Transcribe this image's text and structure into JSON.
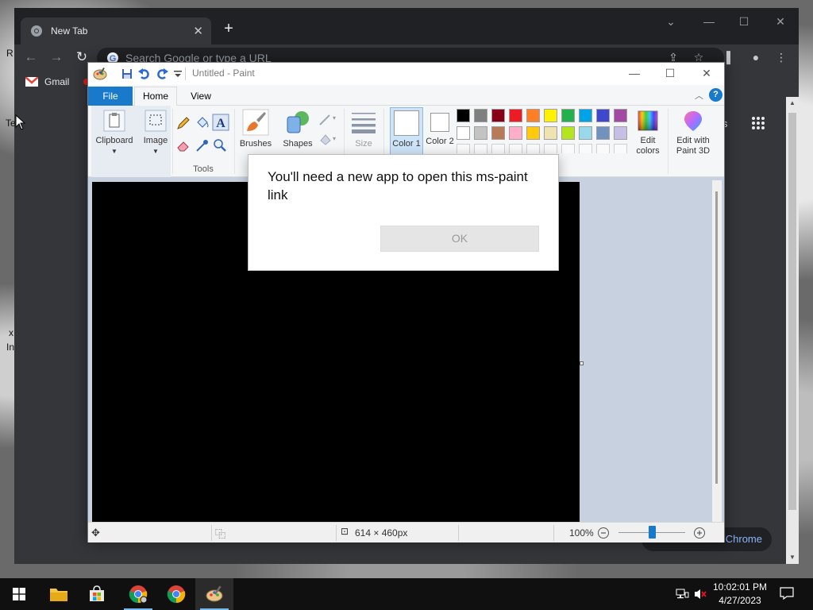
{
  "chrome": {
    "tab_title": "New Tab",
    "tab_close": "✕",
    "new_tab": "+",
    "omnibox_placeholder": "Search Google or type a URL",
    "bookmark_gmail": "Gmail",
    "shortcut_label": "s",
    "customize_label": "Chrome",
    "left_partial_1": "R",
    "left_partial_2": "Te",
    "left_partial_3": "x",
    "left_partial_4": "In"
  },
  "paint": {
    "window_title": "Untitled - Paint",
    "tabs": {
      "file": "File",
      "home": "Home",
      "view": "View"
    },
    "help": "?",
    "ribbon": {
      "clipboard": "Clipboard",
      "image": "Image",
      "tools": "Tools",
      "brushes": "Brushes",
      "shapes": "Shapes",
      "size": "Size",
      "color1": "Color 1",
      "color2": "Color 2",
      "edit_colors": "Edit colors",
      "edit_paint3d": "Edit with Paint 3D"
    },
    "palette_row1": [
      "#000000",
      "#7f7f7f",
      "#880015",
      "#ed1c24",
      "#ff7f27",
      "#fff200",
      "#22b14c",
      "#00a2e8",
      "#3f48cc",
      "#a349a4"
    ],
    "palette_row2": [
      "#ffffff",
      "#c3c3c3",
      "#b97a57",
      "#ffaec9",
      "#ffc90e",
      "#efe4b0",
      "#b5e61d",
      "#99d9ea",
      "#7092be",
      "#c8bfe7"
    ],
    "status": {
      "dimensions": "614 × 460px",
      "zoom": "100%"
    }
  },
  "dialog": {
    "message": "You'll need a new app to open this ms-paint link",
    "ok": "OK"
  },
  "taskbar": {
    "time": "10:02:01 PM",
    "date": "4/27/2023"
  }
}
